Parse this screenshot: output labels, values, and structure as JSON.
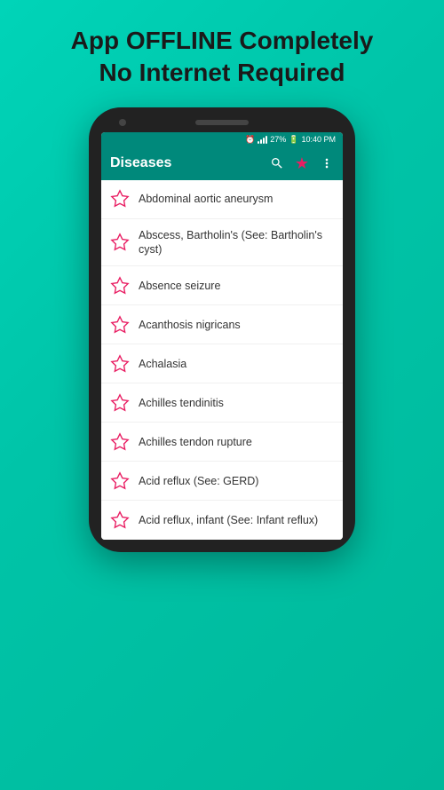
{
  "header": {
    "line1": "App OFFLINE Completely",
    "line2": "No Internet Required"
  },
  "statusBar": {
    "time": "10:40 PM",
    "battery": "27%"
  },
  "appBar": {
    "title": "Diseases"
  },
  "diseases": [
    {
      "id": 1,
      "name": "Abdominal aortic aneurysm"
    },
    {
      "id": 2,
      "name": "Abscess, Bartholin's (See: Bartholin's cyst)"
    },
    {
      "id": 3,
      "name": "Absence seizure"
    },
    {
      "id": 4,
      "name": "Acanthosis nigricans"
    },
    {
      "id": 5,
      "name": "Achalasia"
    },
    {
      "id": 6,
      "name": "Achilles tendinitis"
    },
    {
      "id": 7,
      "name": "Achilles tendon rupture"
    },
    {
      "id": 8,
      "name": "Acid reflux (See: GERD)"
    },
    {
      "id": 9,
      "name": "Acid reflux, infant (See: Infant reflux)"
    }
  ]
}
